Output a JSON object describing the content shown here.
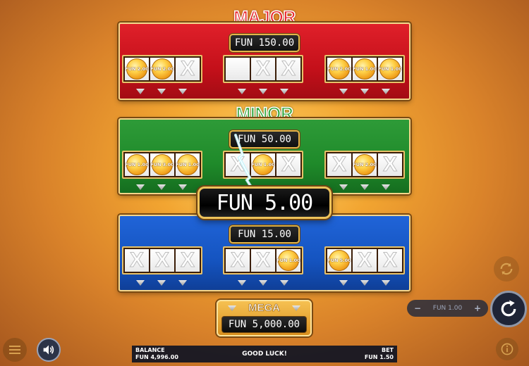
{
  "tiers": {
    "major": {
      "title": "MAJOR",
      "prize": "FUN 150.00",
      "groups": [
        [
          "FUN 2.00",
          "FUN 2.00",
          "X"
        ],
        [
          "",
          "X",
          "X"
        ],
        [
          "FUN 2.00",
          "FUN 1.00",
          "FUN 1.00"
        ]
      ]
    },
    "minor": {
      "title": "MINOR",
      "prize": "FUN 50.00",
      "groups": [
        [
          "FUN 1.00",
          "FUN 3.00",
          "FUN 1.00"
        ],
        [
          "X",
          "FUN 1.00",
          "X"
        ],
        [
          "X",
          "FUN 2.00",
          "X"
        ]
      ]
    },
    "minimum": {
      "prize": "FUN 15.00",
      "groups": [
        [
          "X",
          "X",
          "X"
        ],
        [
          "X",
          "X",
          "FUN 1.00"
        ],
        [
          "FUN 5.00",
          "X",
          "X"
        ]
      ]
    }
  },
  "win_amount": "FUN 5.00",
  "mega": {
    "title": "MEGA",
    "prize": "FUN 5,000.00"
  },
  "bottom_bar": {
    "balance_label": "BALANCE",
    "balance_value": "FUN 4,996.00",
    "message": "GOOD LUCK!",
    "bet_label": "BET",
    "bet_value": "FUN 1.50"
  },
  "bet_stepper": {
    "minus": "−",
    "value": "FUN 1.00",
    "plus": "+"
  },
  "icons": {
    "menu": "hamburger-icon",
    "sound": "speaker-icon",
    "autoplay": "autoplay-icon",
    "spin": "spin-icon",
    "info": "info-icon"
  },
  "colors": {
    "major": "#d8141e",
    "minor": "#1f8a2a",
    "minimum": "#1554c0",
    "gold": "#efc35a"
  }
}
